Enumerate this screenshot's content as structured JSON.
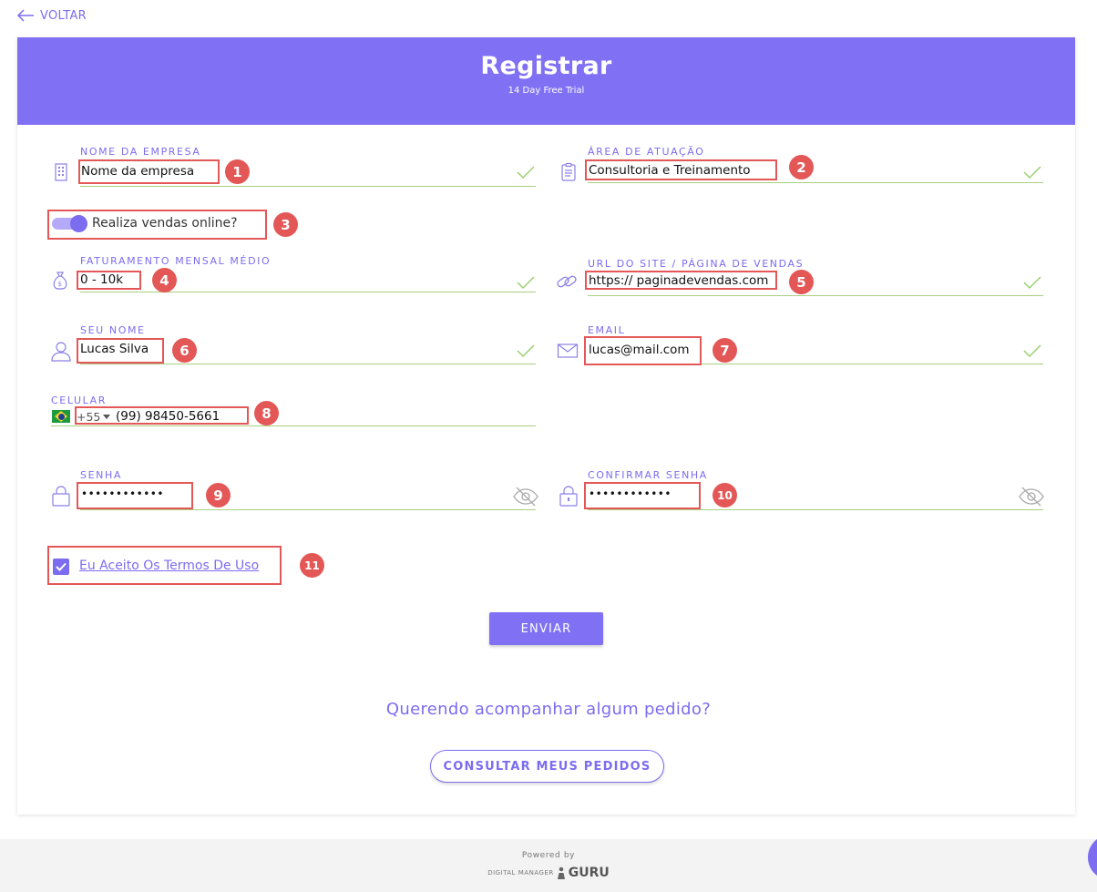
{
  "back": {
    "label": "VOLTAR"
  },
  "header": {
    "title": "Registrar",
    "subtitle": "14 Day Free Trial"
  },
  "form": {
    "company_name": {
      "label": "NOME DA EMPRESA",
      "value": "Nome da empresa"
    },
    "area": {
      "label": "ÁREA DE ATUAÇÃO",
      "value": "Consultoria e Treinamento"
    },
    "online_sales": {
      "label": "Realiza vendas online?",
      "enabled": true
    },
    "revenue": {
      "label": "FATURAMENTO MENSAL MÉDIO",
      "value": "0 - 10k"
    },
    "site_url": {
      "label": "URL DO SITE / PÁGINA DE VENDAS",
      "value": "https:// paginadevendas.com"
    },
    "name": {
      "label": "SEU NOME",
      "value": "Lucas Silva"
    },
    "email": {
      "label": "EMAIL",
      "value": "lucas@mail.com"
    },
    "phone": {
      "label": "CELULAR",
      "country_code": "+55",
      "value": "(99) 98450-5661"
    },
    "password": {
      "label": "SENHA",
      "value": "••••••••••••"
    },
    "confirm_password": {
      "label": "CONFIRMAR SENHA",
      "value": "••••••••••••"
    },
    "terms": {
      "label": "Eu Aceito Os Termos De Uso",
      "checked": true
    }
  },
  "annotations": [
    "1",
    "2",
    "3",
    "4",
    "5",
    "6",
    "7",
    "8",
    "9",
    "10",
    "11"
  ],
  "actions": {
    "submit_label": "ENVIAR",
    "question": "Querendo acompanhar algum pedido?",
    "orders_label": "CONSULTAR MEUS PEDIDOS"
  },
  "footer": {
    "powered_by": "Powered by",
    "brand_small": "DIGITAL MANAGER",
    "brand_big": "GURU"
  },
  "colors": {
    "accent": "#8070f4",
    "valid_line": "#a7cf7f",
    "annotation": "#e45757"
  }
}
